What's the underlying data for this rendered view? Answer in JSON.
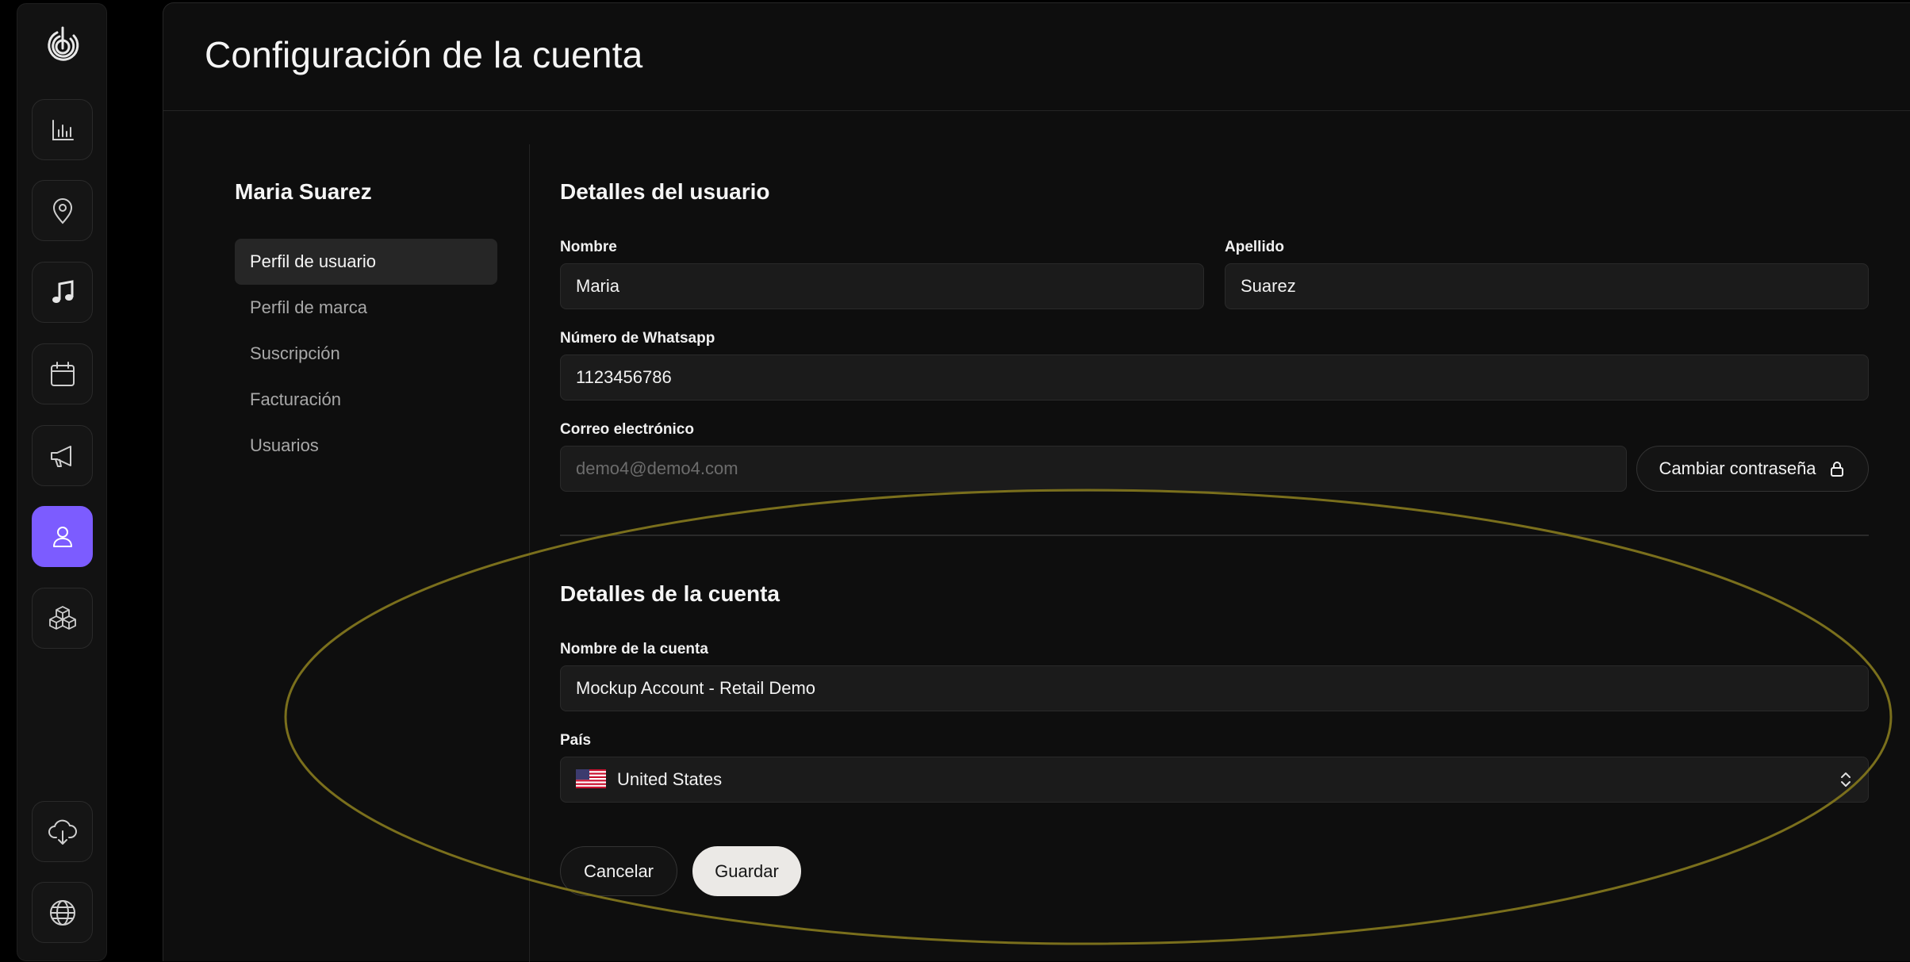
{
  "app": {
    "accent_color": "#7c5cff",
    "annotation_color": "#7a6f1c"
  },
  "rail": {
    "logo_icon": "spiral-logo-icon",
    "items": [
      {
        "icon": "bar-chart-icon",
        "active": false
      },
      {
        "icon": "map-pin-icon",
        "active": false
      },
      {
        "icon": "music-note-icon",
        "active": false
      },
      {
        "icon": "calendar-icon",
        "active": false
      },
      {
        "icon": "megaphone-icon",
        "active": false
      },
      {
        "icon": "user-icon",
        "active": true
      },
      {
        "icon": "cubes-icon",
        "active": false
      }
    ],
    "bottom_items": [
      {
        "icon": "cloud-download-icon"
      },
      {
        "icon": "globe-icon"
      }
    ]
  },
  "header": {
    "title": "Configuración de la cuenta"
  },
  "sidebar": {
    "user_name": "Maria Suarez",
    "items": [
      {
        "label": "Perfil de usuario",
        "active": true
      },
      {
        "label": "Perfil de marca",
        "active": false
      },
      {
        "label": "Suscripción",
        "active": false
      },
      {
        "label": "Facturación",
        "active": false
      },
      {
        "label": "Usuarios",
        "active": false
      }
    ]
  },
  "user_details": {
    "title": "Detalles del usuario",
    "first_name": {
      "label": "Nombre",
      "value": "Maria"
    },
    "last_name": {
      "label": "Apellido",
      "value": "Suarez"
    },
    "whatsapp": {
      "label": "Número de Whatsapp",
      "value": "1123456786"
    },
    "email": {
      "label": "Correo electrónico",
      "placeholder": "demo4@demo4.com"
    },
    "change_password_label": "Cambiar contraseña",
    "change_password_icon": "lock-icon"
  },
  "account_details": {
    "title": "Detalles de la cuenta",
    "account_name": {
      "label": "Nombre de la cuenta",
      "value": "Mockup Account - Retail Demo"
    },
    "country": {
      "label": "País",
      "value": "United States",
      "flag_icon": "us-flag-icon",
      "chevron_icon": "chevron-up-down-icon"
    }
  },
  "actions": {
    "cancel_label": "Cancelar",
    "save_label": "Guardar"
  }
}
